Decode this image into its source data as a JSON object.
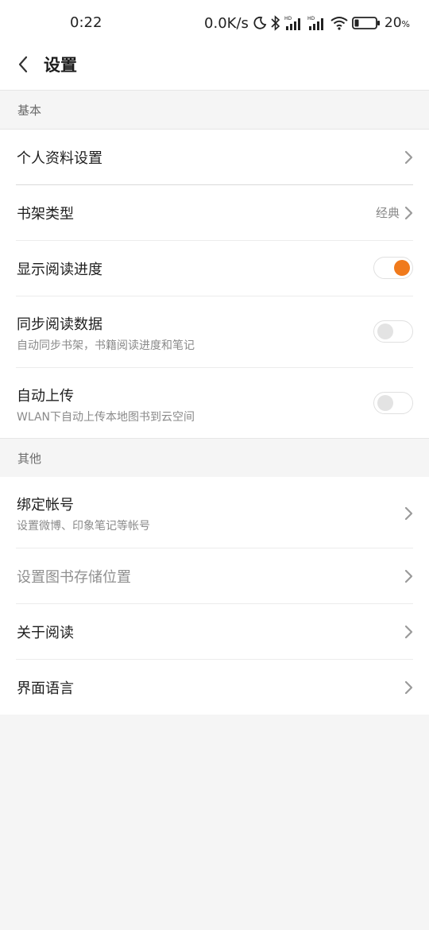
{
  "status_bar": {
    "time": "0:22",
    "network_speed": "0.0K/s",
    "battery_percent": "20",
    "battery_unit": "%",
    "battery_level": 0.2,
    "icons": [
      "moon-icon",
      "bluetooth-icon",
      "hd-signal-icon",
      "hd-signal-icon",
      "wifi-icon",
      "battery-icon"
    ]
  },
  "header": {
    "title": "设置"
  },
  "sections": {
    "basic": {
      "title": "基本",
      "profile": {
        "label": "个人资料设置"
      },
      "shelf_type": {
        "label": "书架类型",
        "value": "经典"
      },
      "show_progress": {
        "label": "显示阅读进度",
        "on": true
      },
      "sync_data": {
        "label": "同步阅读数据",
        "description": "自动同步书架，书籍阅读进度和笔记",
        "on": false
      },
      "auto_upload": {
        "label": "自动上传",
        "description": "WLAN下自动上传本地图书到云空间",
        "on": false
      }
    },
    "other": {
      "title": "其他",
      "bind_account": {
        "label": "绑定帐号",
        "description": "设置微博、印象笔记等帐号"
      },
      "storage_location": {
        "label": "设置图书存储位置"
      },
      "about": {
        "label": "关于阅读"
      },
      "language": {
        "label": "界面语言"
      }
    }
  },
  "colors": {
    "accent": "#f07a1c",
    "background": "#f5f5f5"
  }
}
